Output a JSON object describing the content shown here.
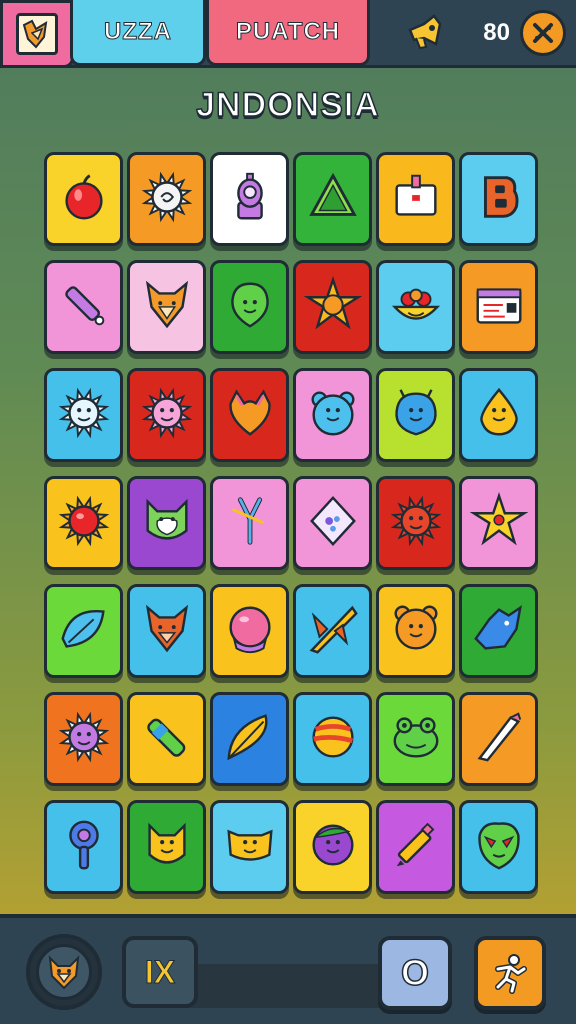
{
  "header": {
    "tab_left": "UZZA",
    "tab_right": "PUATCH",
    "coins": "80"
  },
  "board": {
    "title": "JNDONSIA",
    "rows": [
      [
        {
          "icon": "apple-icon",
          "color": "#f9d22a"
        },
        {
          "icon": "spiky-sun-icon",
          "color": "#f59a24"
        },
        {
          "icon": "purple-robot-icon",
          "color": "#ffffff"
        },
        {
          "icon": "green-triangle-icon",
          "color": "#34b33a"
        },
        {
          "icon": "calendar-box-icon",
          "color": "#f9b81c"
        },
        {
          "icon": "letter-b-icon",
          "color": "#5ccdee"
        }
      ],
      [
        {
          "icon": "pencil-icon",
          "color": "#f294d8"
        },
        {
          "icon": "fox-face-icon",
          "color": "#f7c3e2"
        },
        {
          "icon": "green-alien-icon",
          "color": "#2faa34"
        },
        {
          "icon": "golden-star-emblem-icon",
          "color": "#d8281d"
        },
        {
          "icon": "cupcake-icon",
          "color": "#5ccdee"
        },
        {
          "icon": "ticket-card-icon",
          "color": "#f59a24"
        }
      ],
      [
        {
          "icon": "sun-face-icon",
          "color": "#44c0ea"
        },
        {
          "icon": "pink-sun-icon",
          "color": "#d8281d"
        },
        {
          "icon": "orange-heart-icon",
          "color": "#d8281d"
        },
        {
          "icon": "blue-bear-icon",
          "color": "#f294d8"
        },
        {
          "icon": "blue-blob-icon",
          "color": "#b8e02f"
        },
        {
          "icon": "yellow-drop-icon",
          "color": "#44c0ea"
        }
      ],
      [
        {
          "icon": "red-gem-icon",
          "color": "#f9c21c"
        },
        {
          "icon": "green-cat-icon",
          "color": "#9a48d0"
        },
        {
          "icon": "slingshot-icon",
          "color": "#f294d8"
        },
        {
          "icon": "diamond-sign-icon",
          "color": "#f294d8"
        },
        {
          "icon": "red-spiky-monster-icon",
          "color": "#d8281d"
        },
        {
          "icon": "yellow-star-icon",
          "color": "#f294d8"
        }
      ],
      [
        {
          "icon": "blue-leaf-icon",
          "color": "#6bd93a"
        },
        {
          "icon": "orange-fox-icon",
          "color": "#44c0ea"
        },
        {
          "icon": "pink-ball-icon",
          "color": "#f9c21c"
        },
        {
          "icon": "crossed-swords-icon",
          "color": "#44c0ea"
        },
        {
          "icon": "orange-bear-icon",
          "color": "#f9c21c"
        },
        {
          "icon": "blue-wolf-icon",
          "color": "#2faa34"
        }
      ],
      [
        {
          "icon": "purple-spiky-icon",
          "color": "#f0731f"
        },
        {
          "icon": "green-bottle-icon",
          "color": "#f9c21c"
        },
        {
          "icon": "yellow-feather-icon",
          "color": "#2b82e0"
        },
        {
          "icon": "striped-ball-icon",
          "color": "#44c0ea"
        },
        {
          "icon": "green-frog-icon",
          "color": "#6bd93a"
        },
        {
          "icon": "knife-icon",
          "color": "#f59a24"
        }
      ],
      [
        {
          "icon": "blue-key-icon",
          "color": "#44c0ea"
        },
        {
          "icon": "yellow-cat-icon",
          "color": "#2faa34"
        },
        {
          "icon": "yellow-cat-face-icon",
          "color": "#5ccdee"
        },
        {
          "icon": "purple-orb-icon",
          "color": "#f9d22a"
        },
        {
          "icon": "yellow-pencil-icon",
          "color": "#c55ae0"
        },
        {
          "icon": "green-mask-icon",
          "color": "#44c0ea"
        }
      ]
    ]
  },
  "footer": {
    "multiplier": "IX",
    "o_button": "O"
  }
}
